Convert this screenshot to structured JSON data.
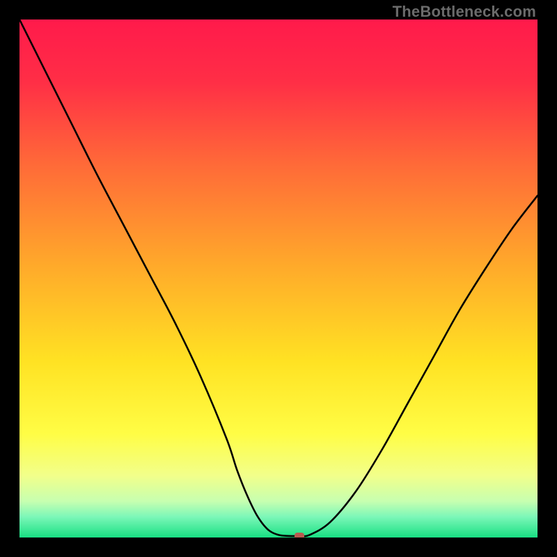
{
  "watermark": "TheBottleneck.com",
  "chart_data": {
    "type": "line",
    "title": "",
    "xlabel": "",
    "ylabel": "",
    "xlim": [
      0,
      100
    ],
    "ylim": [
      0,
      100
    ],
    "series": [
      {
        "name": "bottleneck-curve",
        "x": [
          0,
          5,
          10,
          15,
          20,
          25,
          30,
          35,
          40,
          42,
          44,
          46,
          48,
          50,
          52,
          54,
          56,
          60,
          65,
          70,
          75,
          80,
          85,
          90,
          95,
          100
        ],
        "values": [
          100,
          90,
          80,
          70,
          60.5,
          51,
          41.5,
          31,
          19,
          13,
          8,
          4,
          1.5,
          0.5,
          0.3,
          0.3,
          0.5,
          3,
          9,
          17,
          26,
          35,
          44,
          52,
          59.5,
          66
        ]
      }
    ],
    "marker": {
      "x": 54,
      "y": 0.3
    },
    "gradient_stops": [
      {
        "pct": 0,
        "color": "#ff1a4b"
      },
      {
        "pct": 12,
        "color": "#ff2e46"
      },
      {
        "pct": 28,
        "color": "#ff6a38"
      },
      {
        "pct": 48,
        "color": "#ffab2a"
      },
      {
        "pct": 66,
        "color": "#ffe223"
      },
      {
        "pct": 80,
        "color": "#fffd45"
      },
      {
        "pct": 88,
        "color": "#f2ff8a"
      },
      {
        "pct": 93,
        "color": "#c7ffb0"
      },
      {
        "pct": 96,
        "color": "#7cf7b8"
      },
      {
        "pct": 100,
        "color": "#18e083"
      }
    ]
  }
}
